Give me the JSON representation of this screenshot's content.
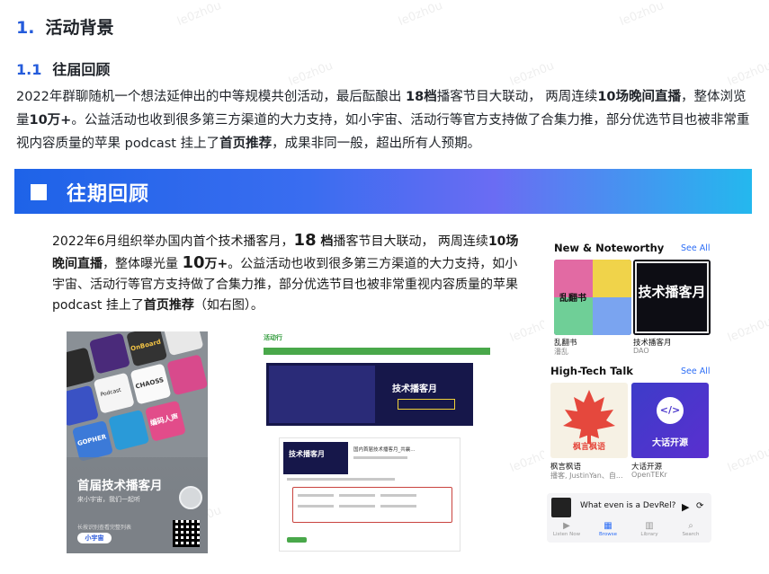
{
  "watermark": "le0zh0u",
  "section": {
    "number": "1.",
    "title": "活动背景"
  },
  "subsection": {
    "number": "1.1",
    "title": "往届回顾"
  },
  "intro": {
    "p1": "2022年群聊随机一个想法延伸出的中等规模共创活动，最后酝酿出 ",
    "b1": "18档",
    "p2": "播客节目大联动， 两周连续",
    "b2": "10场晚间直播",
    "p3": "，整体浏览量",
    "b3": "10万+",
    "p4": "。公益活动也收到很多第三方渠道的大力支持，如小宇宙、活动行等官方支持做了合集力推，部分优选节目也被非常重视内容质量的苹果 podcast 挂上了",
    "b4": "首页推荐",
    "p5": "，成果非同一般，超出所有人预期。"
  },
  "banner": {
    "title": "往期回顾"
  },
  "detail": {
    "p1": "2022年6月组织举办国内首个技术播客月，",
    "big1": "18",
    "b1": " 档",
    "p2": "播客节目大联动， 两周连续",
    "b2": "10场晚间直播",
    "p3": "，整体曝光量 ",
    "big2": "10",
    "b3": "万+",
    "p4": "。公益活动也收到很多第三方渠道的大力支持，如小宇宙、活动行等官方支持做了合集力推，部分优选节目也被非常重视内容质量的苹果 podcast 挂上了",
    "b4": "首页推荐",
    "p5": "（如右图）。"
  },
  "poster": {
    "title": "首届技术播客月",
    "subtitle": "来小宇宙，我们一起听",
    "footer": "长按识别查看完整列表",
    "brand": "小宇宙",
    "tile_labels": [
      "OnBoard",
      "Podcast",
      "CHAOSS",
      "GOPHER",
      "编码人声"
    ]
  },
  "webpage": {
    "logo": "活动行",
    "hero_title": "技术播客月",
    "panel_title": "技术播客月",
    "panel_heading": "国内首届技术播客月_共襄..."
  },
  "podcast_app": {
    "sections": [
      {
        "title": "New & Noteworthy",
        "see_all": "See All",
        "shows": [
          {
            "title": "乱翻书",
            "sub": "潘乱",
            "cover_text": "乱翻书"
          },
          {
            "title": "技术播客月",
            "sub": "DAO",
            "cover_text": "技术播客月"
          }
        ]
      },
      {
        "title": "High-Tech Talk",
        "see_all": "See All",
        "shows": [
          {
            "title": "枫言枫语",
            "sub": "播客, JustinYan、自...",
            "cover_text": "枫言枫语"
          },
          {
            "title": "大话开源",
            "sub": "OpenTEKr",
            "cover_text": "大话开源"
          }
        ]
      }
    ],
    "now_playing": "What even is a DevRel?",
    "tabs": [
      "Listen Now",
      "Browse",
      "Library",
      "Search"
    ],
    "active_tab": "Browse"
  },
  "colors": {
    "accent": "#245bdb",
    "banner_start": "#1e63e8",
    "banner_end": "#24b8ee",
    "link_blue": "#2d6ef6"
  }
}
